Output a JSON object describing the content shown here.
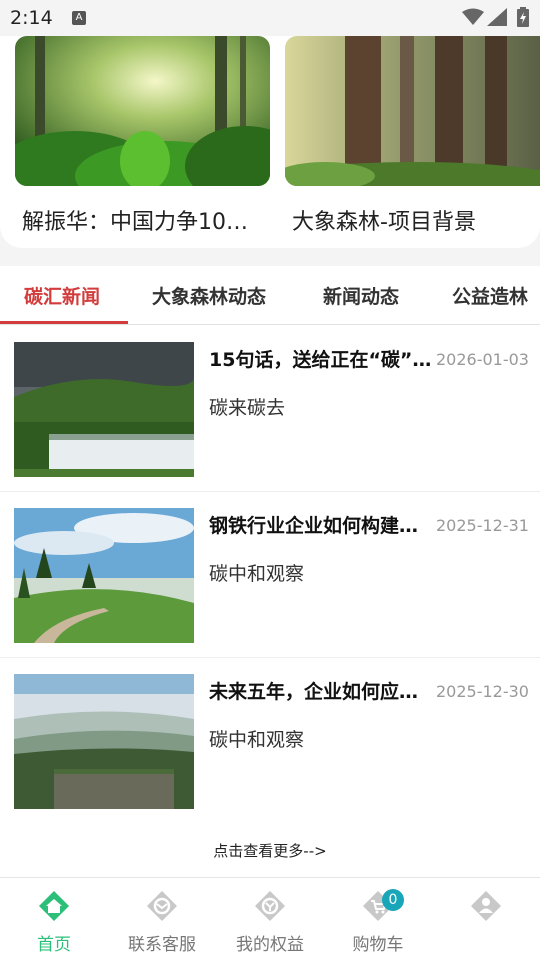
{
  "status_bar": {
    "time": "2:14",
    "a_icon": "A"
  },
  "features": [
    {
      "caption": "解振华：中国力争10…"
    },
    {
      "caption": "大象森林-项目背景"
    }
  ],
  "tabs": [
    {
      "label": "碳汇新闻",
      "active": true
    },
    {
      "label": "大象森林动态"
    },
    {
      "label": "新闻动态"
    },
    {
      "label": "公益造林"
    }
  ],
  "news": [
    {
      "title": "15句话，送给正在“碳”…",
      "date": "2026-01-03",
      "source": "碳来碳去"
    },
    {
      "title": "钢铁行业企业如何构建…",
      "date": "2025-12-31",
      "source": "碳中和观察"
    },
    {
      "title": "未来五年，企业如何应…",
      "date": "2025-12-30",
      "source": "碳中和观察"
    }
  ],
  "more_link": "点击查看更多-->",
  "bottom_nav": [
    {
      "label": "首页",
      "icon": "home-icon",
      "active": true
    },
    {
      "label": "联系客服",
      "icon": "service-icon"
    },
    {
      "label": "我的权益",
      "icon": "benefits-icon"
    },
    {
      "label": "购物车",
      "icon": "cart-icon",
      "badge": "0"
    },
    {
      "label": "",
      "icon": "profile-icon"
    }
  ],
  "colors": {
    "accent_red": "#d23c3c",
    "nav_green": "#2bbf7a",
    "badge": "#19a6b8"
  }
}
